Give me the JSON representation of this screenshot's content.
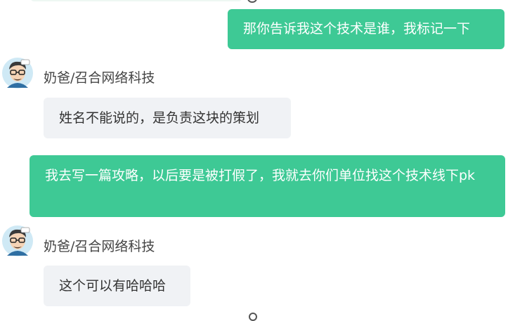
{
  "messages": [
    {
      "role": "outgoing",
      "text": "那你告诉我这个技术是谁，我标记一下"
    },
    {
      "role": "incoming",
      "sender": "奶爸/召合网络科技",
      "avatar": "cartoon-man-avatar",
      "text": "姓名不能说的，是负责这块的策划"
    },
    {
      "role": "outgoing",
      "text": "我去写一篇攻略，以后要是被打假了，我就去你们单位找这个技术线下pk"
    },
    {
      "role": "incoming",
      "sender": "奶爸/召合网络科技",
      "avatar": "cartoon-man-avatar",
      "text": "这个可以有哈哈哈"
    }
  ],
  "colors": {
    "outgoing_bubble": "#3ec995",
    "incoming_bubble": "#f0f2f5",
    "background": "#ffffff"
  }
}
